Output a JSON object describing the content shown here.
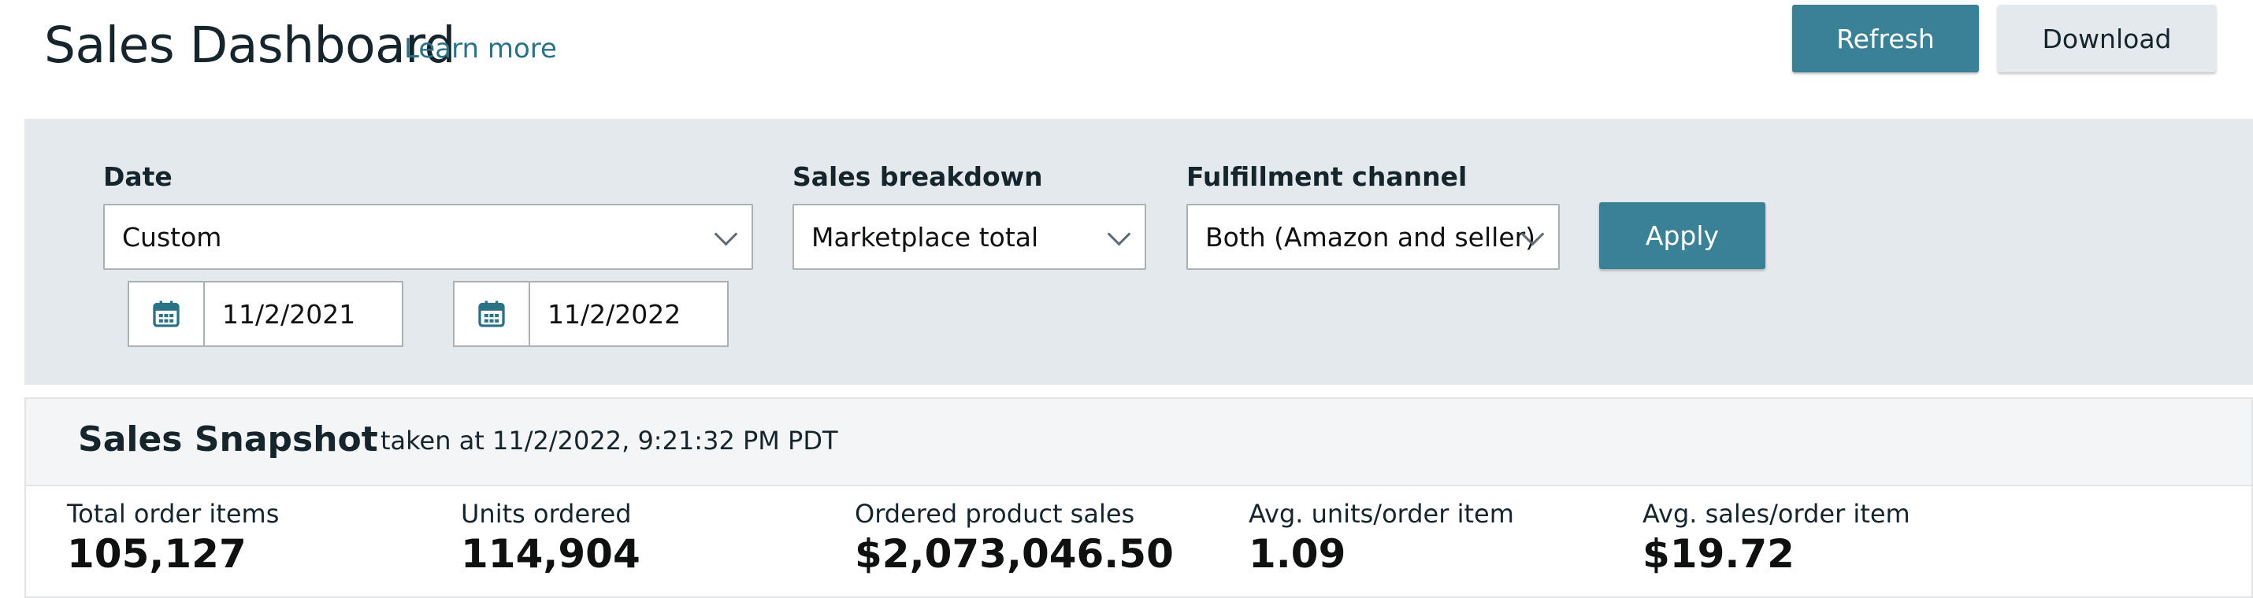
{
  "header": {
    "title": "Sales Dashboard",
    "learn_more": "Learn more",
    "refresh_label": "Refresh",
    "download_label": "Download"
  },
  "filters": {
    "date_label": "Date",
    "date_value": "Custom",
    "sales_breakdown_label": "Sales breakdown",
    "sales_breakdown_value": "Marketplace total",
    "fulfillment_label": "Fulfillment channel",
    "fulfillment_value": "Both (Amazon and seller)",
    "apply_label": "Apply",
    "start_date": "11/2/2021",
    "end_date": "11/2/2022",
    "calendar_icon": "calendar-icon",
    "dropdown_icon": "chevron-down-icon"
  },
  "snapshot": {
    "title": "Sales Snapshot",
    "taken_at": "taken at 11/2/2022, 9:21:32 PM PDT",
    "metrics": [
      {
        "label": "Total order items",
        "value": "105,127"
      },
      {
        "label": "Units ordered",
        "value": "114,904"
      },
      {
        "label": "Ordered product sales",
        "value": "$2,073,046.50"
      },
      {
        "label": "Avg. units/order item",
        "value": "1.09"
      },
      {
        "label": "Avg. sales/order item",
        "value": "$19.72"
      }
    ]
  },
  "colors": {
    "primary_button": "#3b8195",
    "filter_panel": "#e3e9ec",
    "link": "#2a7387",
    "heading": "#16252c"
  }
}
